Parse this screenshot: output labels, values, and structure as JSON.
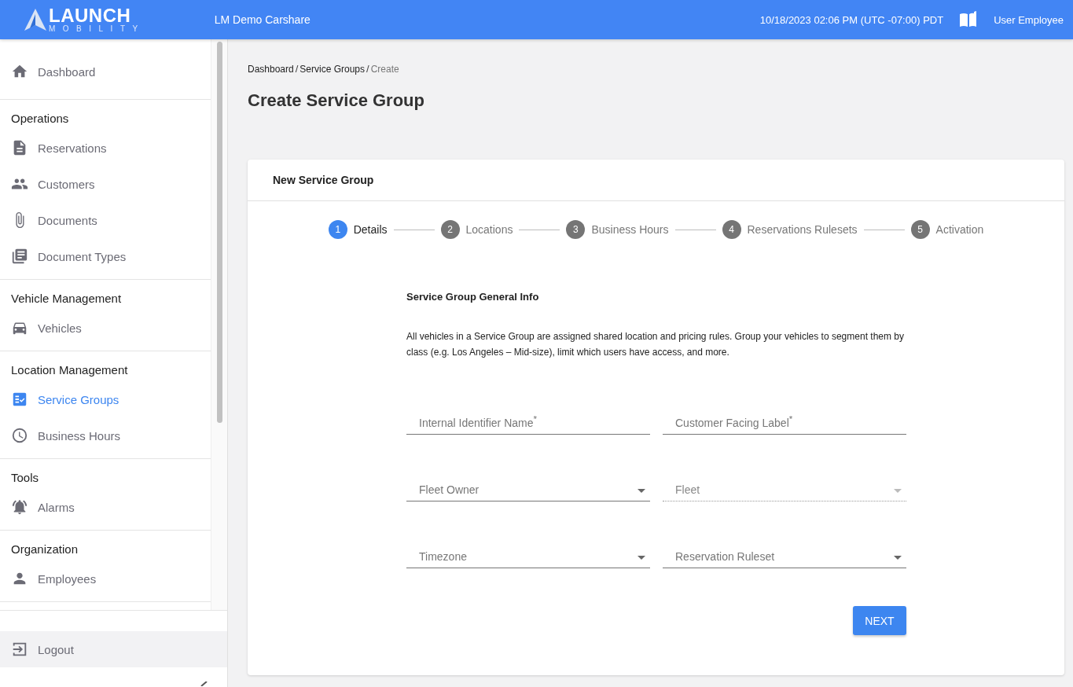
{
  "header": {
    "logo_top": "LAUNCH",
    "logo_bottom": "MOBILITY",
    "tenant": "LM Demo Carshare",
    "datetime": "10/18/2023 02:06 PM (UTC -07:00) PDT",
    "user": "User Employee"
  },
  "sidebar": {
    "sections": [
      {
        "items": [
          {
            "label": "Dashboard",
            "selected": false
          }
        ]
      },
      {
        "title": "Operations",
        "items": [
          {
            "label": "Reservations",
            "selected": false
          },
          {
            "label": "Customers",
            "selected": false
          },
          {
            "label": "Documents",
            "selected": false
          },
          {
            "label": "Document Types",
            "selected": false
          }
        ]
      },
      {
        "title": "Vehicle Management",
        "items": [
          {
            "label": "Vehicles",
            "selected": false
          }
        ]
      },
      {
        "title": "Location Management",
        "items": [
          {
            "label": "Service Groups",
            "selected": true
          },
          {
            "label": "Business Hours",
            "selected": false
          }
        ]
      },
      {
        "title": "Tools",
        "items": [
          {
            "label": "Alarms",
            "selected": false
          }
        ]
      },
      {
        "title": "Organization",
        "items": [
          {
            "label": "Employees",
            "selected": false
          }
        ]
      }
    ],
    "logout": "Logout"
  },
  "breadcrumb": [
    {
      "label": "Dashboard",
      "current": false
    },
    {
      "separator": "/",
      "label": "Service Groups",
      "current": false
    },
    {
      "separator": "/",
      "label": "Create",
      "current": true
    }
  ],
  "page_title": "Create Service Group",
  "card": {
    "title": "New Service Group",
    "steps": [
      {
        "number": "1",
        "label": "Details",
        "selected": true
      },
      {
        "number": "2",
        "label": "Locations",
        "selected": false
      },
      {
        "number": "3",
        "label": "Business Hours",
        "selected": false
      },
      {
        "number": "4",
        "label": "Reservations Rulesets",
        "selected": false
      },
      {
        "number": "5",
        "label": "Activation",
        "selected": false
      }
    ],
    "section_title": "Service Group General Info",
    "description": "All vehicles in a Service Group are assigned shared location and pricing rules. Group your vehicles to segment them by class (e.g. Los Angeles – Mid-size), limit which users have access, and more.",
    "fields": [
      {
        "kind": "text",
        "placeholder": "Internal Identifier Name$^{*}$",
        "disabled": false
      },
      {
        "kind": "text",
        "placeholder": "Customer Facing Label$^{*}$",
        "disabled": false
      },
      {
        "kind": "select",
        "placeholder": "Fleet Owner",
        "disabled": false
      },
      {
        "kind": "select",
        "placeholder": "Fleet",
        "disabled": true
      },
      {
        "kind": "select",
        "placeholder": "Timezone",
        "disabled": false
      },
      {
        "kind": "select",
        "placeholder": "Reservation Ruleset",
        "disabled": false
      }
    ],
    "button": "NEXT"
  }
}
